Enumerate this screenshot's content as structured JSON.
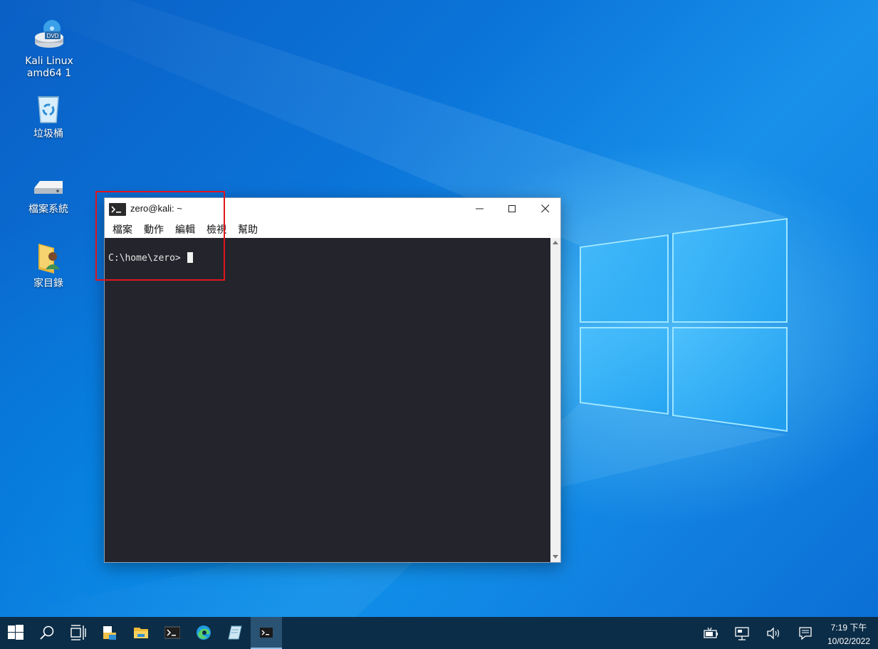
{
  "desktop": {
    "icons": [
      {
        "label": "Kali Linux amd64 1",
        "icon": "dvd-drive-icon"
      },
      {
        "label": "垃圾桶",
        "icon": "recycle-bin-icon"
      },
      {
        "label": "檔案系統",
        "icon": "hard-drive-icon"
      },
      {
        "label": "家目錄",
        "icon": "home-folder-icon"
      }
    ]
  },
  "terminal": {
    "title": "zero@kali: ~",
    "menu": [
      "檔案",
      "動作",
      "編輯",
      "檢視",
      "幫助"
    ],
    "prompt": "C:\\home\\zero> ",
    "dvd_badge": "DVD"
  },
  "taskbar": {
    "buttons": [
      {
        "icon": "start-icon"
      },
      {
        "icon": "search-icon"
      },
      {
        "icon": "task-view-icon"
      },
      {
        "icon": "file-explorer-icon"
      },
      {
        "icon": "folder-icon"
      },
      {
        "icon": "terminal-icon"
      },
      {
        "icon": "edge-icon"
      },
      {
        "icon": "notes-app-icon"
      },
      {
        "icon": "terminal-active-icon",
        "active": true
      }
    ],
    "tray": [
      "battery-icon",
      "network-icon",
      "volume-icon",
      "notification-icon"
    ],
    "clock": {
      "time": "7:19 下午",
      "date": "10/02/2022"
    }
  },
  "colors": {
    "taskbar_bg": "#0c2d47",
    "terminal_bg": "#24252c",
    "highlight": "#e0141e"
  }
}
